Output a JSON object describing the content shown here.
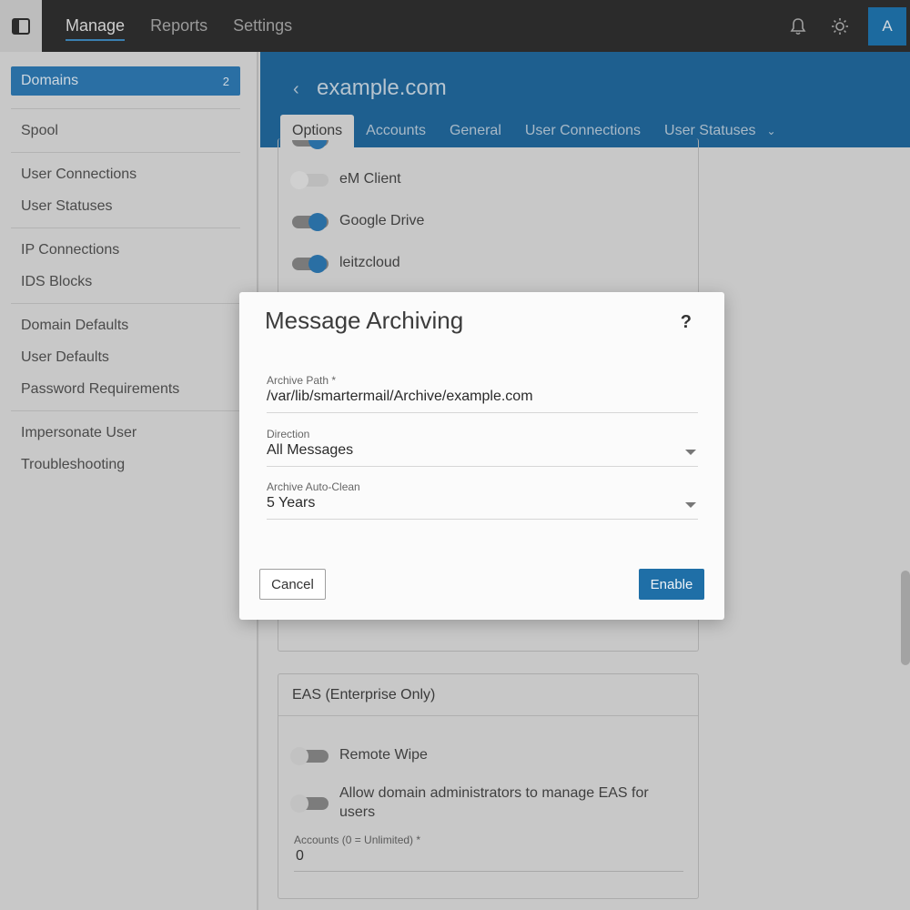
{
  "topbar": {
    "nav": [
      "Manage",
      "Reports",
      "Settings"
    ],
    "avatar_letter": "A",
    "icons": {
      "sidebar_toggle": "sidebar-toggle-icon",
      "notifications": "bell-icon",
      "theme": "sun-icon"
    }
  },
  "sidebar": {
    "groups": [
      [
        {
          "label": "Domains",
          "badge": "2",
          "selected": true
        }
      ],
      [
        {
          "label": "Spool"
        }
      ],
      [
        {
          "label": "User Connections"
        },
        {
          "label": "User Statuses"
        }
      ],
      [
        {
          "label": "IP Connections"
        },
        {
          "label": "IDS Blocks"
        }
      ],
      [
        {
          "label": "Domain Defaults"
        },
        {
          "label": "User Defaults"
        },
        {
          "label": "Password Requirements"
        }
      ],
      [
        {
          "label": "Impersonate User"
        },
        {
          "label": "Troubleshooting"
        }
      ]
    ]
  },
  "header": {
    "domain": "example.com",
    "tabs": [
      "Options",
      "Accounts",
      "General",
      "User Connections",
      "User Statuses"
    ],
    "active_tab": "Options"
  },
  "options_card": {
    "toggles": [
      {
        "label": "eM Client",
        "on": false
      },
      {
        "label": "Google Drive",
        "on": true
      },
      {
        "label": "leitzcloud",
        "on": true
      }
    ]
  },
  "eas_card": {
    "title": "EAS (Enterprise Only)",
    "toggles": [
      {
        "label": "Remote Wipe",
        "on": false
      },
      {
        "label": "Allow domain administrators to manage EAS for users",
        "on": false
      }
    ],
    "accounts_label": "Accounts (0 = Unlimited) *",
    "accounts_value": "0"
  },
  "modal": {
    "title": "Message Archiving",
    "help": "?",
    "fields": [
      {
        "label": "Archive Path *",
        "value": "/var/lib/smartermail/Archive/example.com",
        "dropdown": false
      },
      {
        "label": "Direction",
        "value": "All Messages",
        "dropdown": true
      },
      {
        "label": "Archive Auto-Clean",
        "value": "5 Years",
        "dropdown": true
      }
    ],
    "cancel_label": "Cancel",
    "enable_label": "Enable"
  },
  "colors": {
    "accent": "#1e5f8f",
    "toggle_on": "#2a6fa4",
    "topbar": "#2b2b2b"
  }
}
